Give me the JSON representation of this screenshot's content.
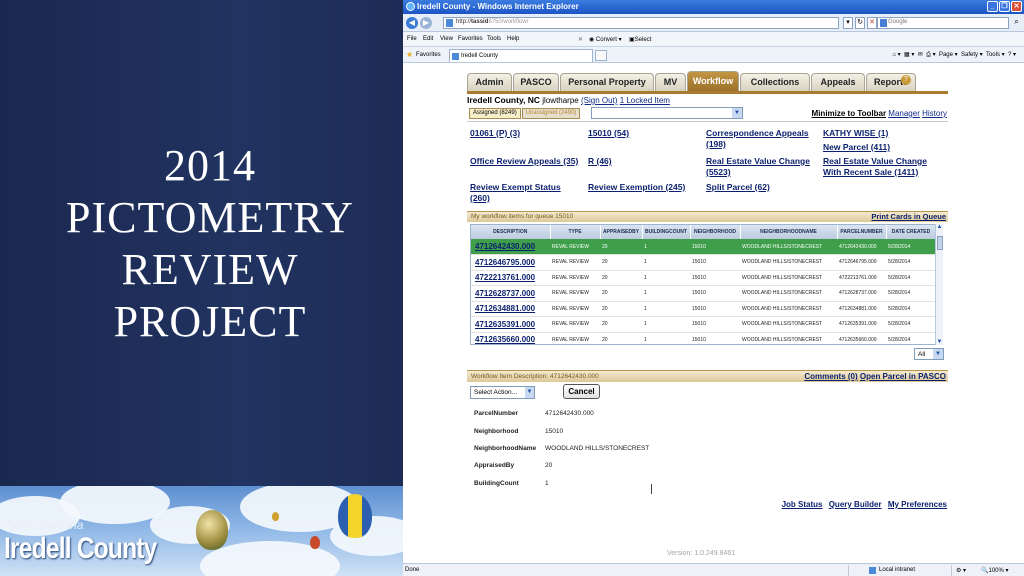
{
  "slide": {
    "title_lines": [
      "2014",
      "PICTOMETRY",
      "REVIEW",
      "PROJECT"
    ],
    "banner": {
      "region": "North Carolina",
      "county": "Iredell County"
    }
  },
  "browser": {
    "window_title": "Iredell County - Windows Internet Explorer",
    "address_prefix": "http://",
    "address_host": "tassid",
    "address_path": "8750/workflow/",
    "search_placeholder": "Google",
    "menu": [
      "File",
      "Edit",
      "View",
      "Favorites",
      "Tools",
      "Help"
    ],
    "convert_label": "Convert",
    "select_label": "Select",
    "favorites_label": "Favorites",
    "tab_title": "Iredell County",
    "command_bar": [
      "Page",
      "Safety",
      "Tools"
    ],
    "status_done": "Done",
    "status_zone": "Local intranet",
    "status_zoom": "100%"
  },
  "app": {
    "tabs": [
      "Admin",
      "PASCO",
      "Personal Property",
      "MV",
      "Workflow",
      "Collections",
      "Appeals",
      "Reports"
    ],
    "active_tab": "Workflow",
    "county": "Iredell County, NC",
    "user": "jlowtharpe",
    "sign_out": "(Sign Out)",
    "locked_item": "1 Locked Item",
    "assigned_tab": "Assigned (8249)",
    "unassigned_tab": "Unassigned (2490)",
    "minimize": "Minimize to Toolbar",
    "manager": "Manager",
    "history": "History",
    "queues": [
      {
        "label": "01061 (P) (3)"
      },
      {
        "label": "15010 (54)"
      },
      {
        "label": "Correspondence Appeals (198)"
      },
      {
        "label": "KATHY WISE (1)"
      },
      {
        "label": "New Parcel (411)"
      },
      {
        "label": "Office Review Appeals (35)"
      },
      {
        "label": "R (46)"
      },
      {
        "label": "Real Estate Value Change (5523)"
      },
      {
        "label": "Real Estate Value Change With Recent Sale (1411)"
      },
      {
        "label": "Review Exempt Status (260)"
      },
      {
        "label": "Review Exemption (245)"
      },
      {
        "label": "Split Parcel (62)"
      }
    ],
    "grid_title": "My workflow items for queue 15010",
    "print_cards": "Print Cards in Queue",
    "columns": [
      "DESCRIPTION",
      "TYPE",
      "APPRAISEDBY",
      "BUILDINGCOUNT",
      "NEIGHBORHOOD",
      "NEIGHBORHOODNAME",
      "PARCELNUMBER",
      "DATE CREATED"
    ],
    "rows": [
      [
        "4712642430.000",
        "REVAL REVIEW",
        "20",
        "1",
        "15010",
        "WOODLAND HILLS/STONECREST",
        "4712642430.000",
        "5/28/2014"
      ],
      [
        "4712646795.000",
        "REVAL REVIEW",
        "20",
        "1",
        "15010",
        "WOODLAND HILLS/STONECREST",
        "4712646795.000",
        "5/28/2014"
      ],
      [
        "4722213761.000",
        "REVAL REVIEW",
        "20",
        "1",
        "15010",
        "WOODLAND HILLS/STONECREST",
        "4722213761.000",
        "5/28/2014"
      ],
      [
        "4712628737.000",
        "REVAL REVIEW",
        "20",
        "1",
        "15010",
        "WOODLAND HILLS/STONECREST",
        "4712628737.000",
        "5/28/2014"
      ],
      [
        "4712634881.000",
        "REVAL REVIEW",
        "20",
        "1",
        "15010",
        "WOODLAND HILLS/STONECREST",
        "4712634881.000",
        "5/28/2014"
      ],
      [
        "4712635391.000",
        "REVAL REVIEW",
        "20",
        "1",
        "15010",
        "WOODLAND HILLS/STONECREST",
        "4712635391.000",
        "5/28/2014"
      ],
      [
        "4712635660.000",
        "REVAL REVIEW",
        "20",
        "1",
        "15010",
        "WOODLAND HILLS/STONECREST",
        "4712635660.000",
        "5/28/2014"
      ]
    ],
    "page_size_option": "All",
    "item_description": "Workflow Item Description: 4712642430.000",
    "comments_link": "Comments (0)",
    "open_parcel_link": "Open Parcel in PASCO",
    "action_placeholder": "Select Action...",
    "cancel_label": "Cancel",
    "details": [
      {
        "key": "ParcelNumber",
        "value": "4712642430.000"
      },
      {
        "key": "Neighborhood",
        "value": "15010"
      },
      {
        "key": "NeighborhoodName",
        "value": "WOODLAND HILLS/STONECREST"
      },
      {
        "key": "AppraisedBy",
        "value": "20"
      },
      {
        "key": "BuildingCount",
        "value": "1"
      }
    ],
    "bottom_links": [
      "Job Status",
      "Query Builder",
      "My Preferences"
    ],
    "version": "Version: 1.0.249.8461"
  }
}
